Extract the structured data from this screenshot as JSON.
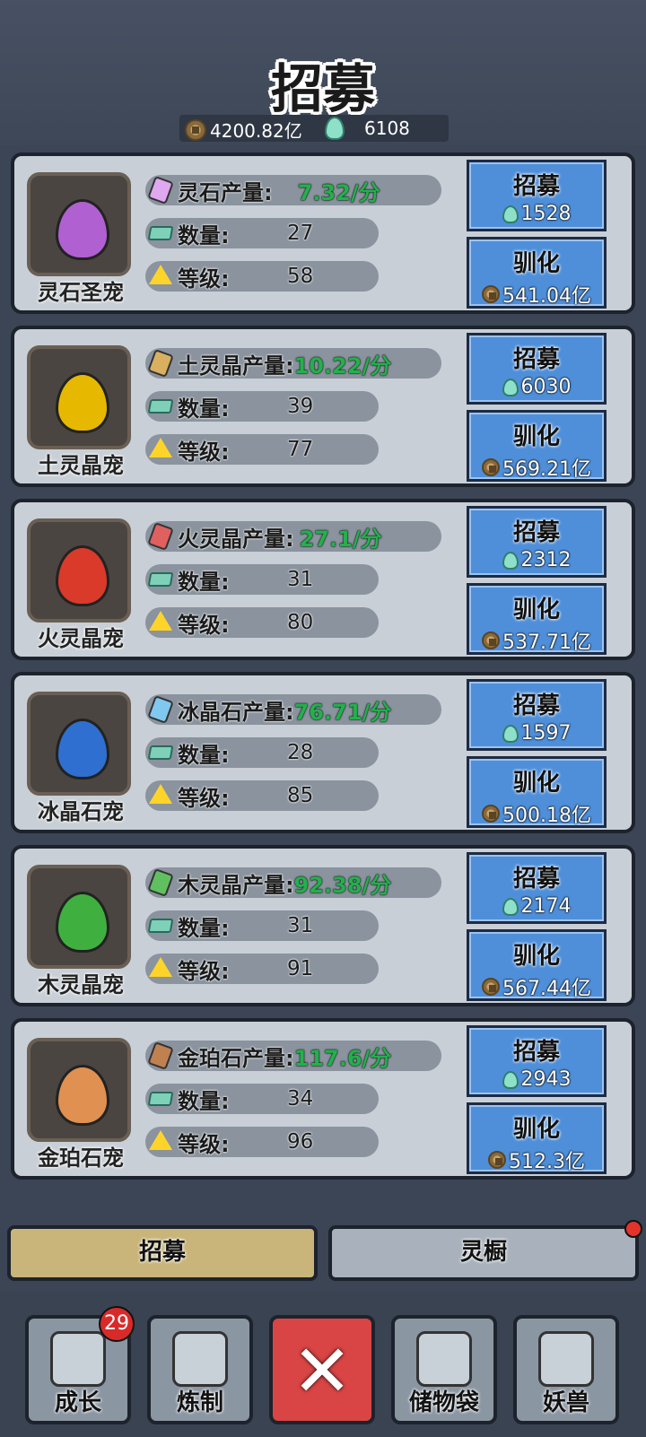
{
  "title": "招募",
  "currency": {
    "coins": "4200.82亿",
    "spirit": "6108"
  },
  "pets": [
    {
      "name": "灵石圣宠",
      "resource": "灵石产量:",
      "rate": "7.32/分",
      "count_label": "数量:",
      "count": "27",
      "level_label": "等级:",
      "level": "58",
      "recruit_label": "招募",
      "recruit_cost": "1528",
      "tame_label": "驯化",
      "tame_cost": "541.04亿",
      "color": "#b060d0",
      "gem_color": "#e0a8f0"
    },
    {
      "name": "土灵晶宠",
      "resource": "土灵晶产量:",
      "rate": "10.22/分",
      "count_label": "数量:",
      "count": "39",
      "level_label": "等级:",
      "level": "77",
      "recruit_label": "招募",
      "recruit_cost": "6030",
      "tame_label": "驯化",
      "tame_cost": "569.21亿",
      "color": "#e6b800",
      "gem_color": "#d8b060"
    },
    {
      "name": "火灵晶宠",
      "resource": "火灵晶产量:",
      "rate": "27.1/分",
      "count_label": "数量:",
      "count": "31",
      "level_label": "等级:",
      "level": "80",
      "recruit_label": "招募",
      "recruit_cost": "2312",
      "tame_label": "驯化",
      "tame_cost": "537.71亿",
      "color": "#d93a2a",
      "gem_color": "#e06060"
    },
    {
      "name": "冰晶石宠",
      "resource": "冰晶石产量:",
      "rate": "76.71/分",
      "count_label": "数量:",
      "count": "28",
      "level_label": "等级:",
      "level": "85",
      "recruit_label": "招募",
      "recruit_cost": "1597",
      "tame_label": "驯化",
      "tame_cost": "500.18亿",
      "color": "#2f6fd0",
      "gem_color": "#80c8f0"
    },
    {
      "name": "木灵晶宠",
      "resource": "木灵晶产量:",
      "rate": "92.38/分",
      "count_label": "数量:",
      "count": "31",
      "level_label": "等级:",
      "level": "91",
      "recruit_label": "招募",
      "recruit_cost": "2174",
      "tame_label": "驯化",
      "tame_cost": "567.44亿",
      "color": "#3fb040",
      "gem_color": "#60c060"
    },
    {
      "name": "金珀石宠",
      "resource": "金珀石产量:",
      "rate": "117.6/分",
      "count_label": "数量:",
      "count": "34",
      "level_label": "等级:",
      "level": "96",
      "recruit_label": "招募",
      "recruit_cost": "2943",
      "tame_label": "驯化",
      "tame_cost": "512.3亿",
      "color": "#e09050",
      "gem_color": "#c08050"
    }
  ],
  "tabs": [
    {
      "label": "招募"
    },
    {
      "label": "灵橱"
    }
  ],
  "dock": [
    {
      "label": "成长",
      "badge": "29"
    },
    {
      "label": "炼制"
    },
    {
      "label": ""
    },
    {
      "label": "储物袋"
    },
    {
      "label": "妖兽"
    }
  ]
}
